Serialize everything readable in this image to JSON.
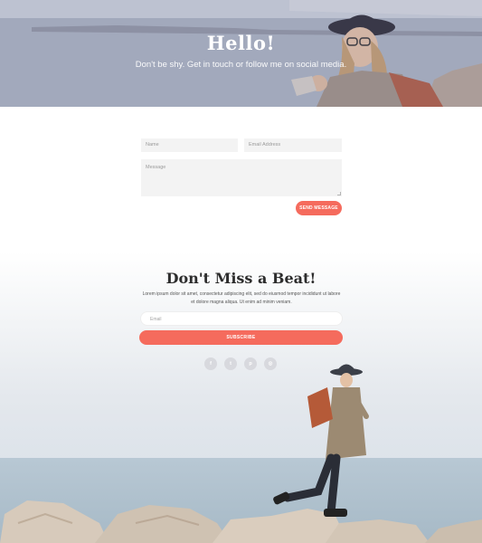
{
  "hero": {
    "title": "Hello!",
    "subtitle": "Don't be shy. Get in touch or follow me on social media."
  },
  "contact_form": {
    "name_placeholder": "Name",
    "email_placeholder": "Email Address",
    "message_placeholder": "Message",
    "send_label": "SEND MESSAGE"
  },
  "newsletter": {
    "title": "Don't Miss a Beat!",
    "body": "Lorem ipsum dolor sit amet, consectetur adipiscing elit, sed do eiusmod tempor incididunt ut labore et dolore magna aliqua. Ut enim ad minim veniam.",
    "email_placeholder": "Email",
    "subscribe_label": "SUBSCRIBE"
  },
  "social_links": [
    {
      "icon": "facebook-icon",
      "glyph": "f"
    },
    {
      "icon": "twitter-icon",
      "glyph": "t"
    },
    {
      "icon": "pinterest-icon",
      "glyph": "p"
    },
    {
      "icon": "instagram-icon",
      "glyph": "◎"
    }
  ],
  "colors": {
    "accent": "#f56b5d",
    "heading": "#2d2d2d",
    "field_bg": "#f3f3f3",
    "social_bg": "#d8d9de"
  }
}
